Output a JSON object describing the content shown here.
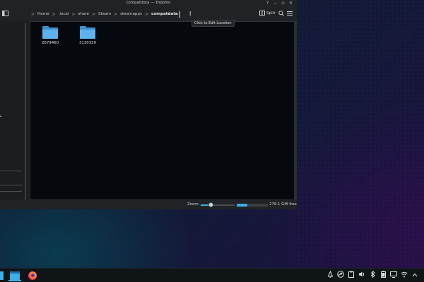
{
  "window": {
    "title": "compatdata — Dolphin",
    "controls": {
      "help": "?",
      "minimize": "⌄",
      "maximize": "◇",
      "close": "✕"
    }
  },
  "toolbar": {
    "panel_toggle_icon": "sidebar-toggle-icon",
    "breadcrumb": [
      "Home",
      ".local",
      "share",
      "Steam",
      "steamapps",
      "compatdata"
    ],
    "breadcrumb_separator": ">",
    "split_label": "Split",
    "search_icon": "search-icon",
    "menu_icon": "hamburger-menu-icon"
  },
  "tooltip": {
    "text": "Click to Edit Location"
  },
  "files": [
    {
      "name": "2679460",
      "type": "folder"
    },
    {
      "name": "3130330",
      "type": "folder"
    }
  ],
  "statusbar": {
    "zoom_label": "Zoom:",
    "zoom_level": 0.3,
    "free_space_label": "276.1 GiB free",
    "disk_used_fraction": 0.35
  },
  "taskbar": {
    "apps": [
      {
        "name": "Dolphin",
        "icon": "dolphin-icon",
        "active": true
      },
      {
        "name": "Firefox",
        "icon": "firefox-icon",
        "active": false
      }
    ],
    "tray_icons": [
      "notifications-icon",
      "steam-icon",
      "clipboard-icon",
      "volume-icon",
      "bluetooth-icon",
      "battery-icon",
      "display-icon",
      "wifi-icon",
      "expand-tray-icon"
    ]
  },
  "colors": {
    "accent": "#3daee9",
    "folder_front": "#5eb3ee",
    "folder_back": "#3d8fcc",
    "window_bg": "#1b1e20",
    "view_bg": "#05090d"
  }
}
